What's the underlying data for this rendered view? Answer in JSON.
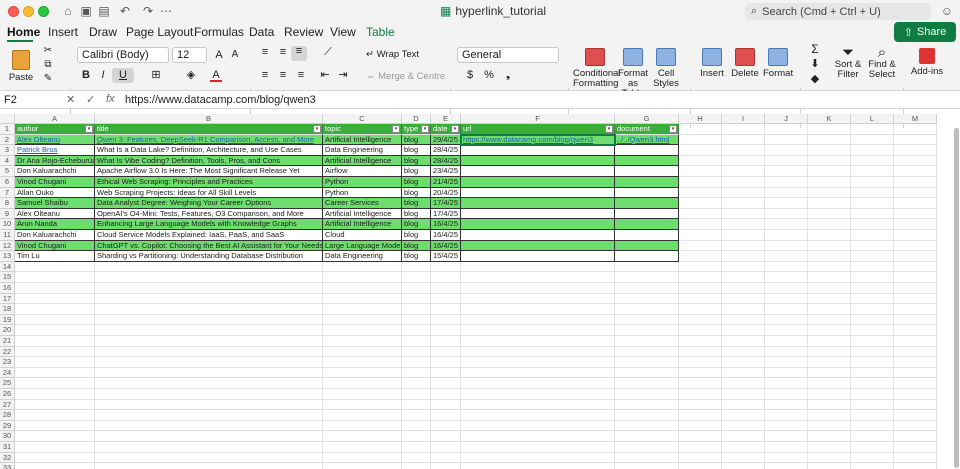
{
  "title_bar": {
    "doc_title": "hyperlink_tutorial",
    "search_placeholder": "Search (Cmd + Ctrl + U)"
  },
  "tabs": [
    "Home",
    "Insert",
    "Draw",
    "Page Layout",
    "Formulas",
    "Data",
    "Review",
    "View",
    "Table"
  ],
  "share_label": "Share",
  "ribbon": {
    "paste": "Paste",
    "font_name": "Calibri (Body)",
    "font_size": "12",
    "wrap_text": "Wrap Text",
    "merge": "Merge & Centre",
    "number_format": "General",
    "cond_format": [
      "Conditional",
      "Formatting"
    ],
    "format_table": [
      "Format",
      "as Table"
    ],
    "cell_styles": [
      "Cell",
      "Styles"
    ],
    "insert": "Insert",
    "delete": "Delete",
    "format": "Format",
    "sort_filter": [
      "Sort &",
      "Filter"
    ],
    "find_select": [
      "Find &",
      "Select"
    ],
    "addins": "Add-ins",
    "bold": "B",
    "italic": "I",
    "underline": "U",
    "percent": "%"
  },
  "formula_bar": {
    "name_box": "F2",
    "fx": "fx",
    "content": "https://www.datacamp.com/blog/qwen3"
  },
  "columns": [
    "A",
    "B",
    "C",
    "D",
    "E",
    "F",
    "G",
    "H",
    "I",
    "J",
    "K",
    "L",
    "M"
  ],
  "row_numbers": [
    "1",
    "2",
    "3",
    "4",
    "5",
    "6",
    "7",
    "8",
    "9",
    "10",
    "11",
    "12",
    "13",
    "14",
    "15",
    "16",
    "17",
    "18",
    "19",
    "20",
    "21",
    "22",
    "23",
    "24",
    "25",
    "26",
    "27",
    "28",
    "29",
    "30",
    "31",
    "32",
    "33"
  ],
  "headers": [
    "author",
    "title",
    "topic",
    "type",
    "date",
    "url",
    "document"
  ],
  "rows": [
    [
      "Alex Olteanu",
      "Qwen 3: Features, DeepSeek-R1 Comparison, Access, and More",
      "Artificial Intelligence",
      "blog",
      "29/4/25",
      "https://www.datacamp.com/blog/qwen3",
      "../../Qwen3.html"
    ],
    [
      "Patrick Brus",
      "What Is a Data Lake? Definition, Architecture, and Use Cases",
      "Data Engineering",
      "blog",
      "28/4/25",
      "",
      ""
    ],
    [
      "Dr Ana Rojo-Echeburúa",
      "What Is Vibe Coding? Definition, Tools, Pros, and Cons",
      "Artificial Intelligence",
      "blog",
      "28/4/25",
      "",
      ""
    ],
    [
      "Don Kaluarachchi",
      "Apache Airflow 3.0 Is Here: The Most Significant Release Yet",
      "Airflow",
      "blog",
      "23/4/25",
      "",
      ""
    ],
    [
      "Vinod Chugani",
      "Ethical Web Scraping: Principles and Practices",
      "Python",
      "blog",
      "21/4/25",
      "",
      ""
    ],
    [
      "Allan Ouko",
      "Web Scraping Projects: Ideas for All Skill Levels",
      "Python",
      "blog",
      "20/4/25",
      "",
      ""
    ],
    [
      "Samuel Shaibu",
      "Data Analyst Degree: Weighing Your Career Options",
      "Career Services",
      "blog",
      "17/4/25",
      "",
      ""
    ],
    [
      "Alex Olteanu",
      "OpenAI's O4-Mini: Tests, Features, O3 Comparison, and More",
      "Artificial Intelligence",
      "blog",
      "17/4/25",
      "",
      ""
    ],
    [
      "Arun Nanda",
      "Enhancing Large Language Models with Knowledge Graphs",
      "Artificial Intelligence",
      "blog",
      "16/4/25",
      "",
      ""
    ],
    [
      "Don Kaluarachchi",
      "Cloud Service Models Explained: IaaS, PaaS, and SaaS",
      "Cloud",
      "blog",
      "16/4/25",
      "",
      ""
    ],
    [
      "Vinod Chugani",
      "ChatGPT vs. Copilot: Choosing the Best AI Assistant for Your Needs",
      "Large Language Models",
      "blog",
      "16/4/25",
      "",
      ""
    ],
    [
      "Tim Lu",
      "Sharding vs Partitioning: Understanding Database Distribution",
      "Data Engineering",
      "blog",
      "15/4/25",
      "",
      ""
    ]
  ],
  "link_rows": {
    "author": [
      "1",
      "2"
    ],
    "title": [
      "1"
    ]
  }
}
